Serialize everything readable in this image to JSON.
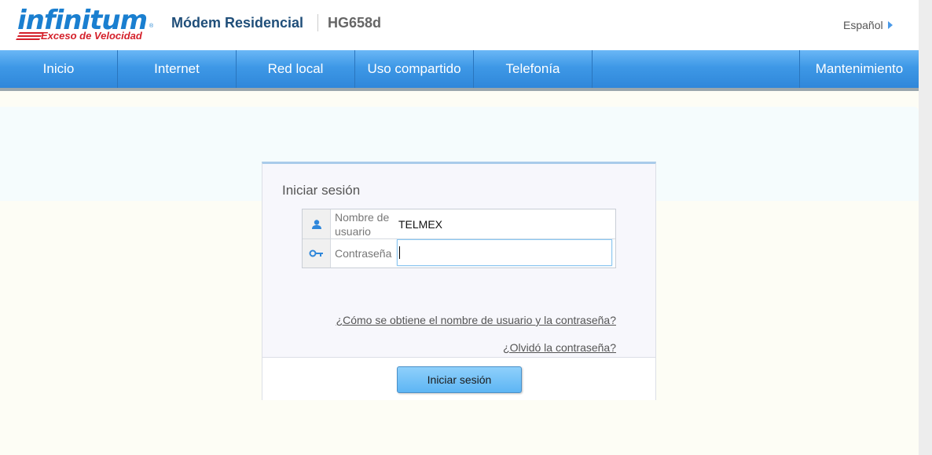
{
  "header": {
    "logo_main": "infinitum",
    "logo_reg": "®",
    "logo_sub": "Exceso de Velocidad",
    "product_name": "Módem Residencial",
    "model_name": "HG658d",
    "language": "Español"
  },
  "nav": {
    "items": [
      {
        "label": "Inicio"
      },
      {
        "label": "Internet"
      },
      {
        "label": "Red local"
      },
      {
        "label": "Uso compartido"
      },
      {
        "label": "Telefonía"
      },
      {
        "label": "Mantenimiento"
      }
    ]
  },
  "login": {
    "title": "Iniciar sesión",
    "username_label": "Nombre de usuario",
    "username_value": "TELMEX",
    "password_label": "Contraseña",
    "password_value": "",
    "help_link": "¿Cómo se obtiene el nombre de usuario y la contraseña?",
    "forgot_link": "¿Olvidó la contraseña?",
    "submit_label": "Iniciar sesión"
  },
  "icons": {
    "user": "user-icon",
    "key": "key-icon",
    "language_arrow": "caret-right-icon"
  },
  "colors": {
    "nav_blue": "#3e98e6",
    "brand_blue": "#1a7fd0",
    "brand_red": "#d4202a",
    "title_blue": "#1f4e79"
  }
}
